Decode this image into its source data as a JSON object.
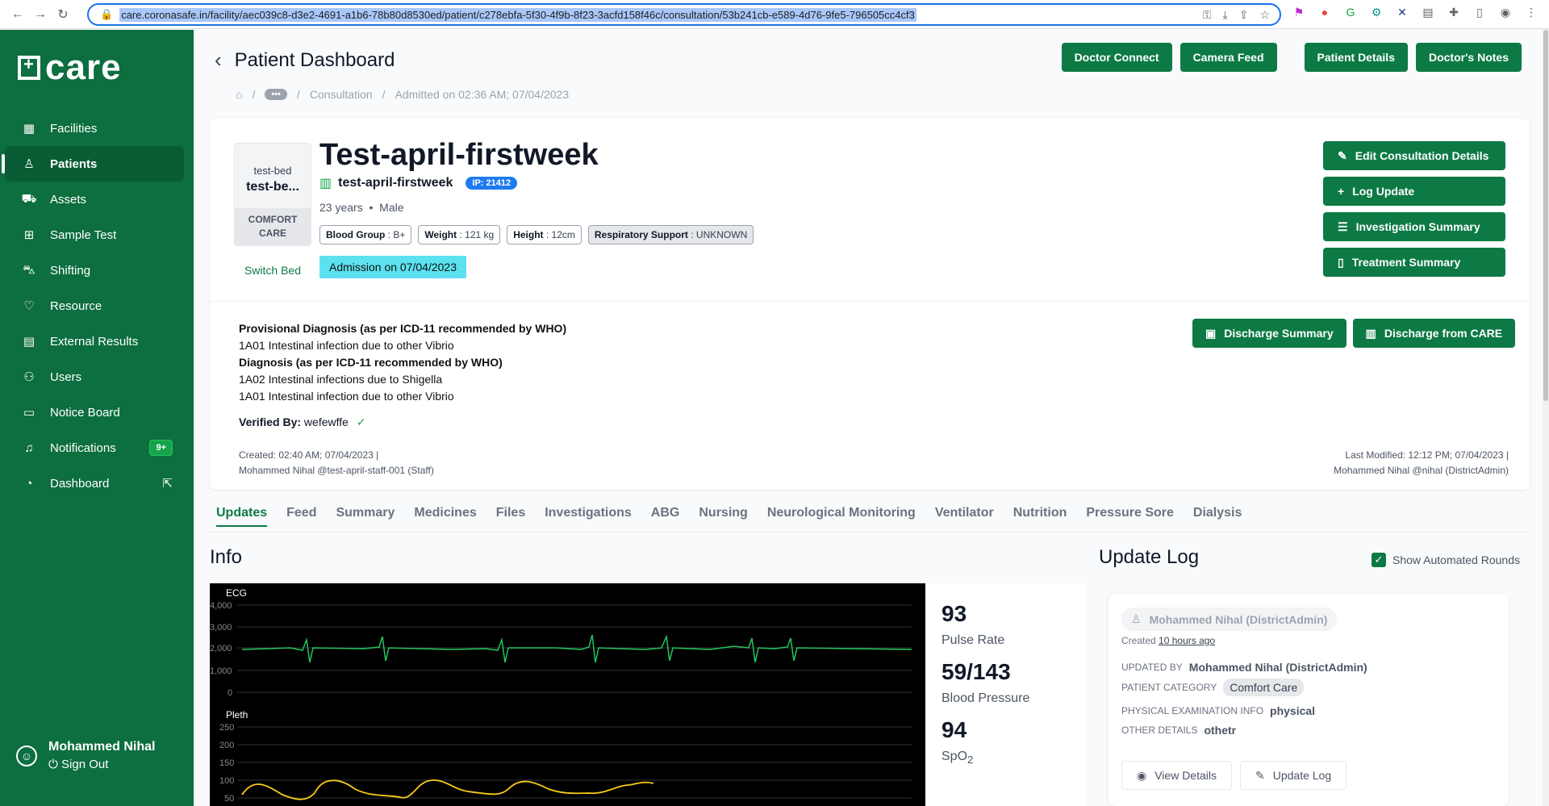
{
  "browser": {
    "url": "care.coronasafe.in/facility/aec039c8-d3e2-4691-a1b6-78b80d8530ed/patient/c278ebfa-5f30-4f9b-8f23-3acfd158f46c/consultation/53b241cb-e589-4d76-9fe5-796505cc4cf3"
  },
  "sidebar": {
    "logo": "care",
    "items": [
      {
        "label": "Facilities",
        "icon": "building-icon"
      },
      {
        "label": "Patients",
        "icon": "user-icon"
      },
      {
        "label": "Assets",
        "icon": "cart-icon"
      },
      {
        "label": "Sample Test",
        "icon": "medkit-icon"
      },
      {
        "label": "Shifting",
        "icon": "ambulance-icon"
      },
      {
        "label": "Resource",
        "icon": "heart-icon"
      },
      {
        "label": "External Results",
        "icon": "clipboard-icon"
      },
      {
        "label": "Users",
        "icon": "users-icon"
      },
      {
        "label": "Notice Board",
        "icon": "board-icon"
      },
      {
        "label": "Notifications",
        "icon": "bell-icon",
        "badge": "9+"
      },
      {
        "label": "Dashboard",
        "icon": "dashboard-icon"
      }
    ],
    "user_name": "Mohammed Nihal",
    "sign_out": "Sign Out"
  },
  "header": {
    "title": "Patient Dashboard",
    "buttons": [
      "Doctor Connect",
      "Camera Feed",
      "Patient Details",
      "Doctor's Notes"
    ],
    "breadcrumb": {
      "dots": "•••",
      "consultation": "Consultation",
      "admitted": "Admitted on 02:36 AM; 07/04/2023"
    }
  },
  "patient": {
    "bed_label": "test-bed",
    "bed_name": "test-be...",
    "bed_category": "COMFORT CARE",
    "switch_bed": "Switch Bed",
    "name": "Test-april-firstweek",
    "facility": "test-april-firstweek",
    "ip": "IP: 21412",
    "age": "23 years",
    "gender": "Male",
    "chips": {
      "blood_group_label": "Blood Group",
      "blood_group": "B+",
      "weight_label": "Weight",
      "weight": "121 kg",
      "height_label": "Height",
      "height": "12cm",
      "resp_label": "Respiratory Support",
      "resp": "UNKNOWN"
    },
    "admission": "Admission on 07/04/2023",
    "actions": [
      "Edit Consultation Details",
      "Log Update",
      "Investigation Summary",
      "Treatment Summary"
    ],
    "discharge": [
      "Discharge Summary",
      "Discharge from CARE"
    ],
    "diag": {
      "prov_title": "Provisional Diagnosis (as per ICD-11 recommended by WHO)",
      "prov_1": "1A01 Intestinal infection due to other Vibrio",
      "diag_title": "Diagnosis (as per ICD-11 recommended by WHO)",
      "diag_1": "1A02 Intestinal infections due to Shigella",
      "diag_2": "1A01 Intestinal infection due to other Vibrio"
    },
    "verified_label": "Verified By:",
    "verified_by": "wefewffe",
    "created_1": "Created: 02:40 AM; 07/04/2023 |",
    "created_2": "Mohammed Nihal @test-april-staff-001 (Staff)",
    "modified_1": "Last Modified: 12:12 PM; 07/04/2023 |",
    "modified_2": "Mohammed Nihal @nihal (DistrictAdmin)"
  },
  "tabs": [
    "Updates",
    "Feed",
    "Summary",
    "Medicines",
    "Files",
    "Investigations",
    "ABG",
    "Nursing",
    "Neurological Monitoring",
    "Ventilator",
    "Nutrition",
    "Pressure Sore",
    "Dialysis"
  ],
  "info": {
    "title": "Info",
    "ecg_label": "ECG",
    "ecg_ticks": [
      "4,000",
      "3,000",
      "2,000",
      "1,000",
      "0"
    ],
    "pleth_label": "Pleth",
    "pleth_ticks": [
      "250",
      "200",
      "150",
      "100",
      "50"
    ],
    "vitals": [
      {
        "value": "93",
        "label": "Pulse Rate"
      },
      {
        "value": "59/143",
        "label": "Blood Pressure"
      },
      {
        "value": "94",
        "label": "SpO"
      }
    ],
    "spo2_sub": "2"
  },
  "update_log": {
    "title": "Update Log",
    "show_automated": "Show Automated Rounds",
    "user": "Mohammed Nihal (DistrictAdmin)",
    "created_label": "Created",
    "created_ago": "10 hours ago",
    "updated_by_label": "UPDATED BY",
    "updated_by": "Mohammed Nihal (DistrictAdmin)",
    "category_label": "PATIENT CATEGORY",
    "category": "Comfort Care",
    "exam_label": "PHYSICAL EXAMINATION INFO",
    "exam": "physical",
    "other_label": "OTHER DETAILS",
    "other": "othetr",
    "view_details": "View Details",
    "update_log_btn": "Update Log"
  },
  "colors": {
    "primary": "#0d7a45",
    "sidebar": "#0d6e3f",
    "admission": "#5ce1f0",
    "ip_badge": "#1e7bf0",
    "ecg": "#22c55e",
    "pleth": "#facc15"
  }
}
